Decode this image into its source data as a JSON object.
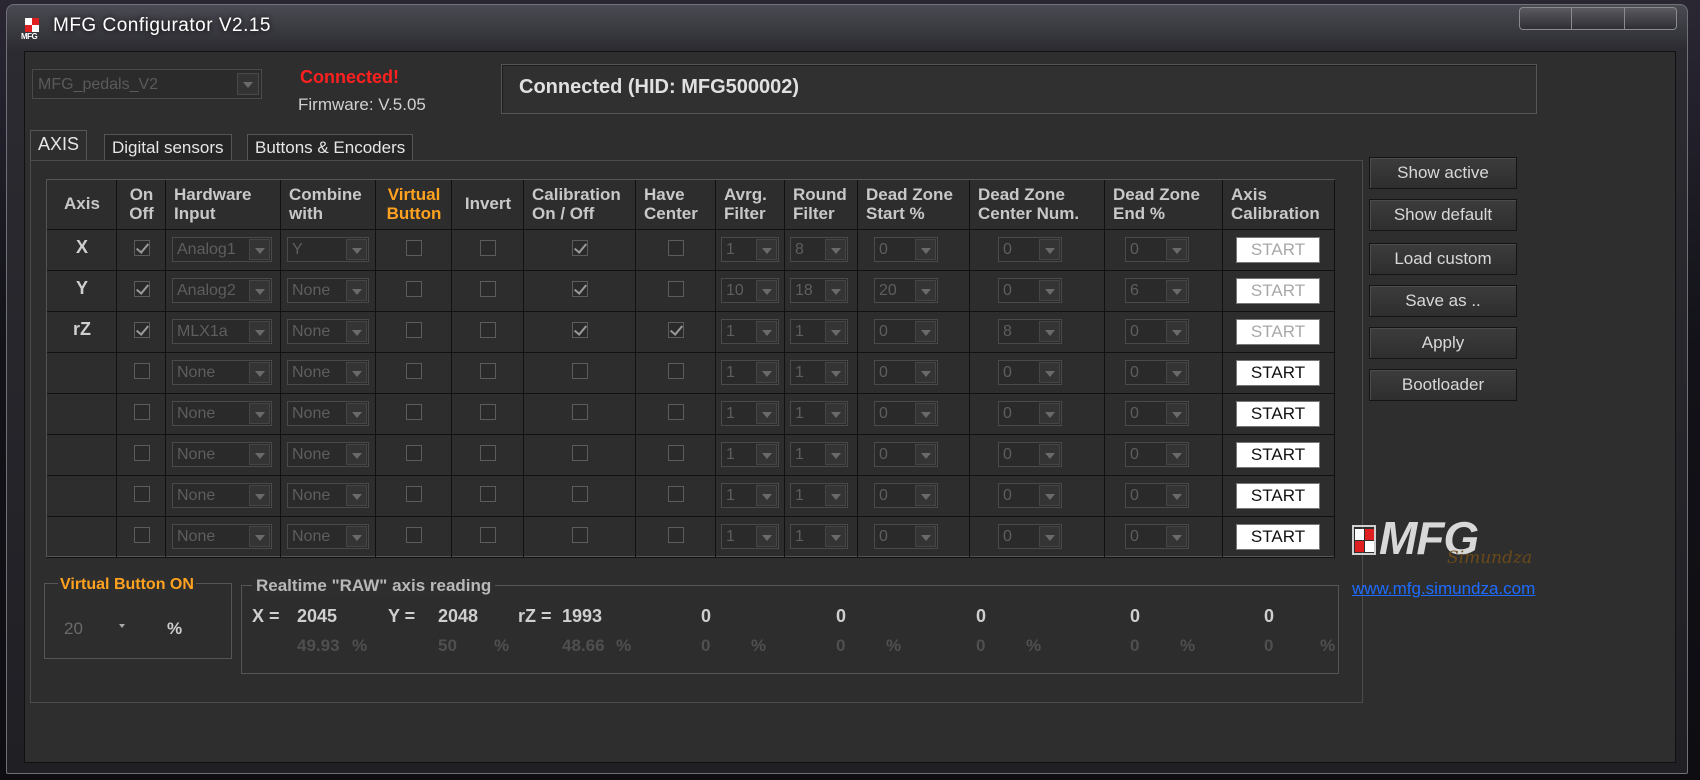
{
  "window": {
    "title": "MFG Configurator V2.15",
    "icon_text": "MFG"
  },
  "device": {
    "selected": "MFG_pedals_V2"
  },
  "connection": {
    "state": "Connected!",
    "firmware": "Firmware: V.5.05",
    "status": "Connected (HID: MFG500002)"
  },
  "tabs": [
    "AXIS",
    "Digital sensors",
    "Buttons & Encoders"
  ],
  "headers": {
    "axis": "Axis",
    "onoff": [
      "On",
      "Off"
    ],
    "hw": [
      "Hardware",
      "Input"
    ],
    "combine": [
      "Combine",
      "with"
    ],
    "virtual": [
      "Virtual",
      "Button"
    ],
    "invert": "Invert",
    "calib": [
      "Calibration",
      "On / Off"
    ],
    "center": [
      "Have",
      "Center"
    ],
    "avrg": [
      "Avrg.",
      "Filter"
    ],
    "round": [
      "Round",
      "Filter"
    ],
    "dzs": [
      "Dead Zone",
      "Start %"
    ],
    "dzc": [
      "Dead Zone",
      "Center Num."
    ],
    "dze": [
      "Dead Zone",
      "End %"
    ],
    "axcal": [
      "Axis",
      "Calibration"
    ]
  },
  "rows": [
    {
      "axis": "X",
      "on": true,
      "hw": "Analog1",
      "combine": "Y",
      "virtual": false,
      "invert": false,
      "calib": true,
      "center": false,
      "avrg": "1",
      "round": "8",
      "dzs": "0",
      "dzc": "0",
      "dze": "0",
      "start": "START",
      "active": true
    },
    {
      "axis": "Y",
      "on": true,
      "hw": "Analog2",
      "combine": "None",
      "virtual": false,
      "invert": false,
      "calib": true,
      "center": false,
      "avrg": "10",
      "round": "18",
      "dzs": "20",
      "dzc": "0",
      "dze": "6",
      "start": "START",
      "active": true
    },
    {
      "axis": "rZ",
      "on": true,
      "hw": "MLX1a",
      "combine": "None",
      "virtual": false,
      "invert": false,
      "calib": true,
      "center": true,
      "avrg": "1",
      "round": "1",
      "dzs": "0",
      "dzc": "8",
      "dze": "0",
      "start": "START",
      "active": true
    },
    {
      "axis": "",
      "on": false,
      "hw": "None",
      "combine": "None",
      "virtual": false,
      "invert": false,
      "calib": false,
      "center": false,
      "avrg": "1",
      "round": "1",
      "dzs": "0",
      "dzc": "0",
      "dze": "0",
      "start": "START",
      "active": false
    },
    {
      "axis": "",
      "on": false,
      "hw": "None",
      "combine": "None",
      "virtual": false,
      "invert": false,
      "calib": false,
      "center": false,
      "avrg": "1",
      "round": "1",
      "dzs": "0",
      "dzc": "0",
      "dze": "0",
      "start": "START",
      "active": false
    },
    {
      "axis": "",
      "on": false,
      "hw": "None",
      "combine": "None",
      "virtual": false,
      "invert": false,
      "calib": false,
      "center": false,
      "avrg": "1",
      "round": "1",
      "dzs": "0",
      "dzc": "0",
      "dze": "0",
      "start": "START",
      "active": false
    },
    {
      "axis": "",
      "on": false,
      "hw": "None",
      "combine": "None",
      "virtual": false,
      "invert": false,
      "calib": false,
      "center": false,
      "avrg": "1",
      "round": "1",
      "dzs": "0",
      "dzc": "0",
      "dze": "0",
      "start": "START",
      "active": false
    },
    {
      "axis": "",
      "on": false,
      "hw": "None",
      "combine": "None",
      "virtual": false,
      "invert": false,
      "calib": false,
      "center": false,
      "avrg": "1",
      "round": "1",
      "dzs": "0",
      "dzc": "0",
      "dze": "0",
      "start": "START",
      "active": false
    }
  ],
  "virtual_button": {
    "label": "Virtual Button ON",
    "value": "20",
    "unit": "%"
  },
  "realtime": {
    "label": "Realtime \"RAW\" axis reading",
    "readings": [
      {
        "name": "X =",
        "raw": "2045",
        "pct": "49.93",
        "unit": "%"
      },
      {
        "name": "Y =",
        "raw": "2048",
        "pct": "50",
        "unit": "%"
      },
      {
        "name": "rZ =",
        "raw": "1993",
        "pct": "48.66",
        "unit": "%"
      },
      {
        "name": "",
        "raw": "0",
        "pct": "0",
        "unit": "%"
      },
      {
        "name": "",
        "raw": "0",
        "pct": "0",
        "unit": "%"
      },
      {
        "name": "",
        "raw": "0",
        "pct": "0",
        "unit": "%"
      },
      {
        "name": "",
        "raw": "0",
        "pct": "0",
        "unit": "%"
      },
      {
        "name": "",
        "raw": "0",
        "pct": "0",
        "unit": "%"
      }
    ]
  },
  "side_buttons": [
    "Show active",
    "Show default",
    "Load custom",
    "Save as ..",
    "Apply",
    "Bootloader"
  ],
  "logo": {
    "word": "MFG",
    "signature": "Simundza"
  },
  "link": "www.mfg.simundza.com",
  "colors": {
    "accent_orange": "#ffa21f",
    "status_red": "#ff2020",
    "link_blue": "#1e6cff"
  }
}
